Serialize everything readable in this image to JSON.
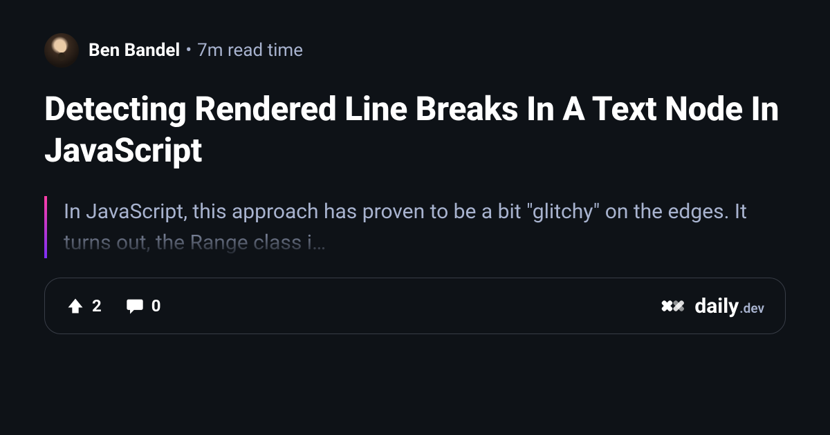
{
  "author": {
    "name": "Ben Bandel"
  },
  "meta": {
    "separator": "•",
    "read_time": "7m read time"
  },
  "title": "Detecting Rendered Line Breaks In A Text Node In JavaScript",
  "excerpt": "In JavaScript, this approach has proven to be a bit \"glitchy\" on the edges. It turns out, the Range class i…",
  "stats": {
    "upvotes": "2",
    "comments": "0"
  },
  "brand": {
    "name": "daily",
    "suffix": ".dev"
  }
}
